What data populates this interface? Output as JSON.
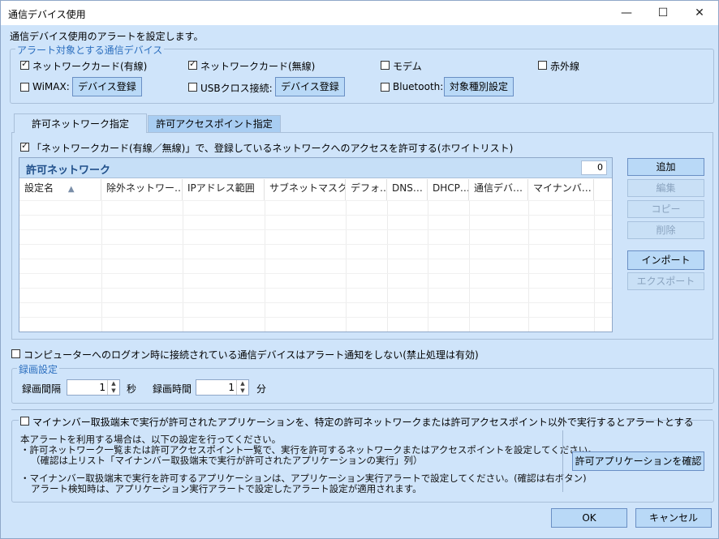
{
  "window": {
    "title": "通信デバイス使用",
    "minimize": "—",
    "maximize": "☐",
    "close": "✕"
  },
  "description": "通信デバイス使用のアラートを設定します。",
  "devices": {
    "legend": "アラート対象とする通信デバイス",
    "nic_wired": {
      "label": "ネットワークカード(有線)",
      "checked": true
    },
    "nic_wireless": {
      "label": "ネットワークカード(無線)",
      "checked": true
    },
    "modem": {
      "label": "モデム",
      "checked": false
    },
    "infrared": {
      "label": "赤外線",
      "checked": false
    },
    "wimax": {
      "label": "WiMAX:",
      "checked": false,
      "button": "デバイス登録"
    },
    "usb_cross": {
      "label": "USBクロス接続:",
      "checked": false,
      "button": "デバイス登録"
    },
    "bluetooth": {
      "label": "Bluetooth:",
      "checked": false,
      "button": "対象種別設定"
    }
  },
  "tabs": {
    "tab1": "許可ネットワーク指定",
    "tab2": "許可アクセスポイント指定",
    "active": "tab1"
  },
  "whitelist": {
    "label": "「ネットワークカード(有線／無線)」で、登録しているネットワークへのアクセスを許可する(ホワイトリスト)",
    "checked": true
  },
  "grid": {
    "title": "許可ネットワーク",
    "count": "0",
    "columns": [
      "設定名",
      "除外ネットワー…",
      "IPアドレス範囲",
      "サブネットマスク",
      "デフォ…",
      "DNS…",
      "DHCP…",
      "通信デバ…",
      "マイナンバ…"
    ],
    "sort_indicator": "▲",
    "rows": []
  },
  "side_buttons": {
    "add": "追加",
    "edit": "編集",
    "copy": "コピー",
    "delete": "削除",
    "import": "インポート",
    "export": "エクスポート"
  },
  "logon": {
    "label": "コンピューターへのログオン時に接続されている通信デバイスはアラート通知をしない(禁止処理は有効)",
    "checked": false
  },
  "recording": {
    "legend": "録画設定",
    "interval_label": "録画間隔",
    "interval_value": "1",
    "interval_unit": "秒",
    "duration_label": "録画時間",
    "duration_value": "1",
    "duration_unit": "分"
  },
  "mynumber": {
    "label": "マイナンバー取扱端末で実行が許可されたアプリケーションを、特定の許可ネットワークまたは許可アクセスポイント以外で実行するとアラートとする",
    "checked": false,
    "notes": [
      "本アラートを利用する場合は、以下の設定を行ってください。",
      "・許可ネットワーク一覧または許可アクセスポイント一覧で、実行を許可するネットワークまたはアクセスポイントを設定してください。",
      "（確認は上リスト「マイナンバー取扱端末で実行が許可されたアプリケーションの実行」列）",
      "・マイナンバー取扱端末で実行を許可するアプリケーションは、アプリケーション実行アラートで設定してください。(確認は右ボタン)",
      "アラート検知時は、アプリケーション実行アラートで設定したアラート設定が適用されます。"
    ],
    "confirm_button": "許可アプリケーションを確認"
  },
  "footer": {
    "ok": "OK",
    "cancel": "キャンセル"
  }
}
